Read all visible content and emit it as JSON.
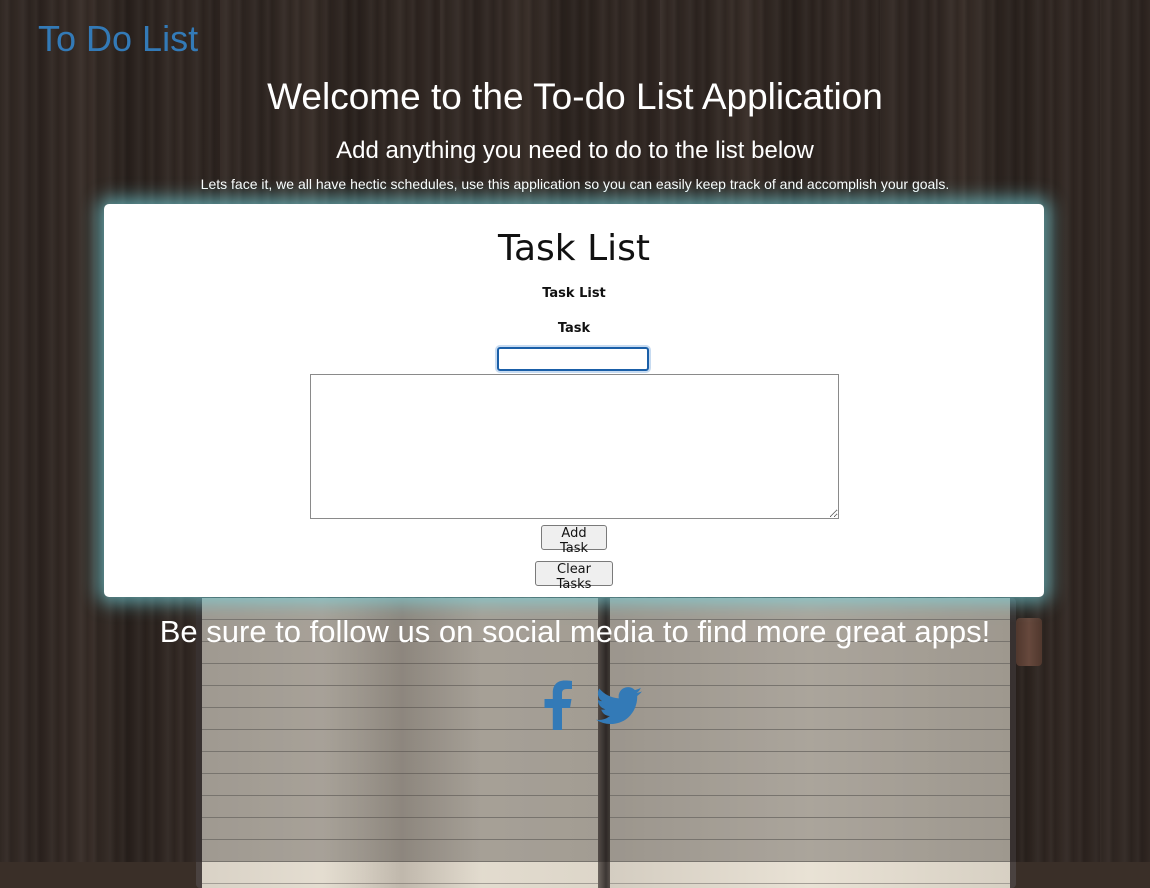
{
  "brand": "To Do List",
  "header": {
    "title": "Welcome to the To-do List Application",
    "subtitle": "Add anything you need to do to the list below",
    "tagline": "Lets face it, we all have hectic schedules, use this application so you can easily keep track of and accomplish your goals."
  },
  "card": {
    "title": "Task List",
    "section_label": "Task List",
    "task_label": "Task",
    "task_input_value": "",
    "task_textarea_value": "",
    "add_button": "Add Task",
    "clear_button": "Clear Tasks"
  },
  "footer": {
    "follow_text": "Be sure to follow us on social media to find more great apps!",
    "social_icons": [
      "facebook-icon",
      "twitter-icon"
    ]
  },
  "colors": {
    "brand": "#337ab7",
    "card_glow": "#78dce6",
    "social": "#337ab7"
  }
}
